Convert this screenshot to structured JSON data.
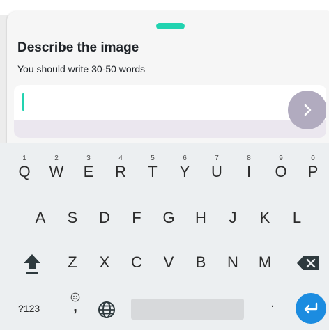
{
  "sheet": {
    "title": "Describe the image",
    "subtitle": "You should write 30-50 words",
    "input_value": "",
    "accent_color": "#22d3b0",
    "next_button_icon": "chevron-right-icon"
  },
  "keyboard": {
    "row1": [
      {
        "label": "Q",
        "hint": "1"
      },
      {
        "label": "W",
        "hint": "2"
      },
      {
        "label": "E",
        "hint": "3"
      },
      {
        "label": "R",
        "hint": "4"
      },
      {
        "label": "T",
        "hint": "5"
      },
      {
        "label": "Y",
        "hint": "6"
      },
      {
        "label": "U",
        "hint": "7"
      },
      {
        "label": "I",
        "hint": "8"
      },
      {
        "label": "O",
        "hint": "9"
      },
      {
        "label": "P",
        "hint": "0"
      }
    ],
    "row2": [
      "A",
      "S",
      "D",
      "F",
      "G",
      "H",
      "J",
      "K",
      "L"
    ],
    "row3": [
      "Z",
      "X",
      "C",
      "V",
      "B",
      "N",
      "M"
    ],
    "shift_icon": "shift-arrow-icon",
    "backspace_icon": "backspace-icon",
    "symbols_label": "?123",
    "comma_label": ",",
    "emoji_icon": "emoji-icon",
    "globe_icon": "globe-icon",
    "period_label": ".",
    "enter_icon": "enter-return-icon",
    "enter_color": "#1c8ce0"
  }
}
